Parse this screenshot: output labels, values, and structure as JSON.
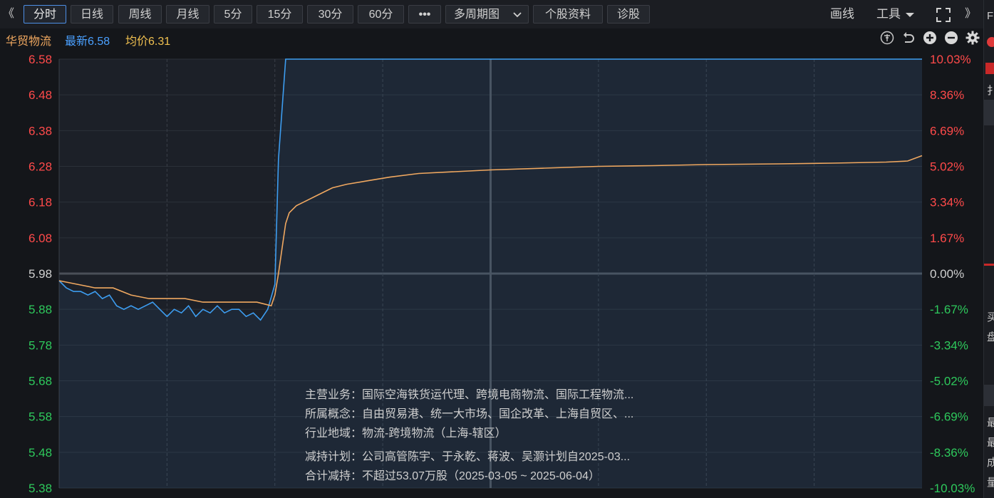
{
  "toolbar": {
    "left_arrow": "《",
    "tabs": [
      {
        "label": "分时",
        "active": true
      },
      {
        "label": "日线"
      },
      {
        "label": "周线"
      },
      {
        "label": "月线"
      },
      {
        "label": "5分"
      },
      {
        "label": "15分"
      },
      {
        "label": "30分"
      },
      {
        "label": "60分"
      },
      {
        "label": "•••"
      }
    ],
    "multi_period": "多周期图",
    "stock_info": "个股资料",
    "diagnose": "诊股",
    "draw_line": "画线",
    "tools": "工具",
    "expand_icon": "expand-icon",
    "right_arrow": "》"
  },
  "stock": {
    "name": "华贸物流",
    "latest_label": "最新",
    "latest_value": "6.58",
    "avg_label": "均价",
    "avg_value": "6.31"
  },
  "colors": {
    "up": "#ff4a4a",
    "down": "#2ec95c",
    "price_line": "#3d9df0",
    "avg_line": "#f0a860",
    "stock_name": "#f0a860",
    "latest": "#4aa0ff",
    "avg": "#f0c050"
  },
  "chart_data": {
    "type": "line",
    "y_left_ticks": [
      "6.58",
      "6.48",
      "6.38",
      "6.28",
      "6.18",
      "6.08",
      "5.98",
      "5.88",
      "5.78",
      "5.68",
      "5.58",
      "5.48",
      "5.38"
    ],
    "y_right_ticks": [
      "10.03%",
      "8.36%",
      "6.69%",
      "5.02%",
      "3.34%",
      "1.67%",
      "0.00%",
      "-1.67%",
      "-3.34%",
      "-5.02%",
      "-6.69%",
      "-8.36%",
      "-10.03%"
    ],
    "ylim": [
      5.38,
      6.58
    ],
    "prev_close": 5.98,
    "x_minutes": 240,
    "series": [
      {
        "name": "最新",
        "points": [
          [
            0,
            5.96
          ],
          [
            2,
            5.94
          ],
          [
            4,
            5.93
          ],
          [
            6,
            5.93
          ],
          [
            8,
            5.92
          ],
          [
            10,
            5.93
          ],
          [
            12,
            5.91
          ],
          [
            14,
            5.92
          ],
          [
            16,
            5.89
          ],
          [
            18,
            5.88
          ],
          [
            20,
            5.89
          ],
          [
            22,
            5.88
          ],
          [
            24,
            5.89
          ],
          [
            26,
            5.9
          ],
          [
            28,
            5.88
          ],
          [
            30,
            5.86
          ],
          [
            32,
            5.88
          ],
          [
            34,
            5.87
          ],
          [
            36,
            5.89
          ],
          [
            38,
            5.86
          ],
          [
            40,
            5.88
          ],
          [
            42,
            5.87
          ],
          [
            44,
            5.89
          ],
          [
            46,
            5.87
          ],
          [
            48,
            5.88
          ],
          [
            50,
            5.88
          ],
          [
            52,
            5.86
          ],
          [
            54,
            5.87
          ],
          [
            56,
            5.85
          ],
          [
            58,
            5.88
          ],
          [
            60,
            5.95
          ],
          [
            61,
            6.3
          ],
          [
            63,
            6.58
          ],
          [
            240,
            6.58
          ]
        ]
      },
      {
        "name": "均价",
        "points": [
          [
            0,
            5.96
          ],
          [
            5,
            5.95
          ],
          [
            10,
            5.94
          ],
          [
            15,
            5.94
          ],
          [
            20,
            5.92
          ],
          [
            25,
            5.91
          ],
          [
            30,
            5.91
          ],
          [
            35,
            5.91
          ],
          [
            40,
            5.9
          ],
          [
            45,
            5.9
          ],
          [
            50,
            5.9
          ],
          [
            55,
            5.9
          ],
          [
            59,
            5.89
          ],
          [
            60,
            5.92
          ],
          [
            61,
            5.98
          ],
          [
            62,
            6.05
          ],
          [
            63,
            6.12
          ],
          [
            64,
            6.15
          ],
          [
            66,
            6.17
          ],
          [
            68,
            6.18
          ],
          [
            72,
            6.2
          ],
          [
            76,
            6.22
          ],
          [
            80,
            6.23
          ],
          [
            86,
            6.24
          ],
          [
            92,
            6.25
          ],
          [
            100,
            6.26
          ],
          [
            110,
            6.265
          ],
          [
            120,
            6.27
          ],
          [
            135,
            6.275
          ],
          [
            150,
            6.28
          ],
          [
            165,
            6.282
          ],
          [
            180,
            6.285
          ],
          [
            200,
            6.287
          ],
          [
            215,
            6.289
          ],
          [
            230,
            6.292
          ],
          [
            236,
            6.295
          ],
          [
            240,
            6.31
          ]
        ]
      }
    ]
  },
  "info": {
    "main_business": "主营业务：国际空海铁货运代理、跨境电商物流、国际工程物流...",
    "concepts": "所属概念：自由贸易港、统一大市场、国企改革、上海自贸区、...",
    "industry": "行业地域：物流-跨境物流（上海-辖区）",
    "reduction_plan": "减持计划：公司高管陈宇、于永乾、蒋波、吴灏计划自2025-03...",
    "reduction_total": "合计减持：不超过53.07万股（2025-03-05 ~ 2025-06-04）"
  },
  "side_chars": [
    "F",
    "扌",
    "买",
    "盘",
    "最",
    "最",
    "成",
    "量"
  ]
}
